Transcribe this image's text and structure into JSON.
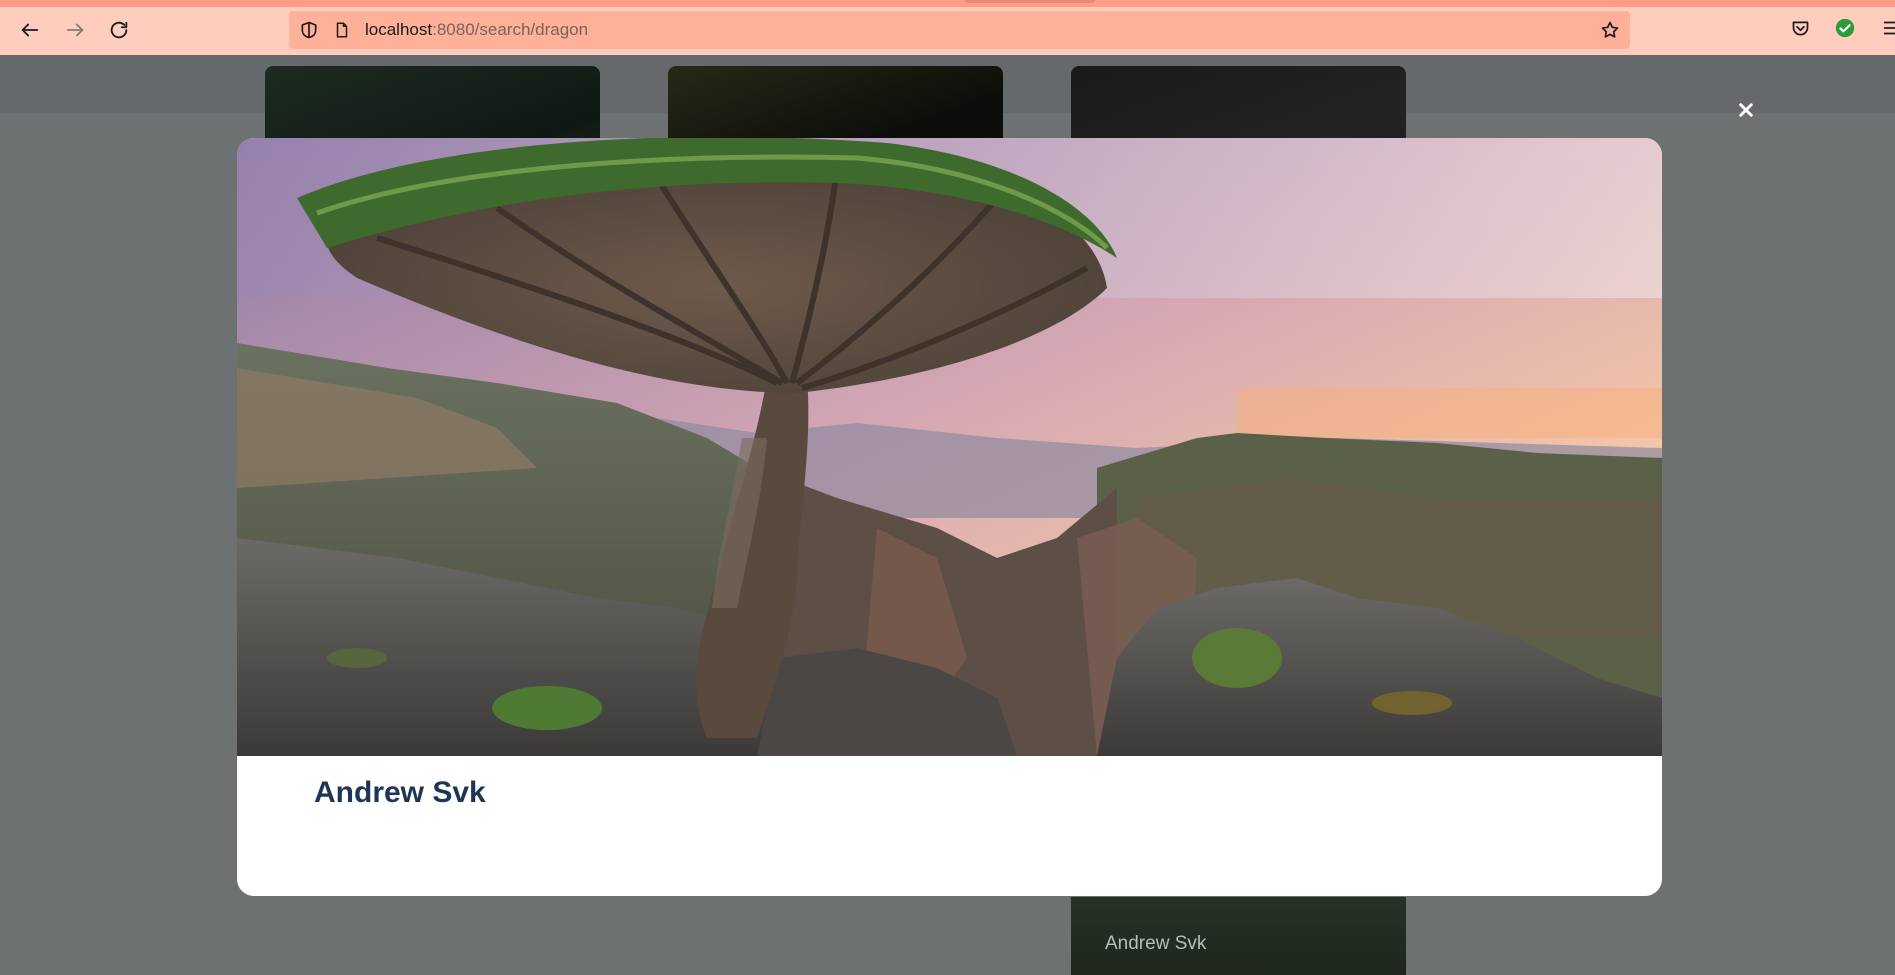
{
  "browser": {
    "url_host": "localhost",
    "url_rest": ":8080/search/dragon",
    "icons": {
      "back": "arrow-left-icon",
      "forward": "arrow-right-icon",
      "reload": "reload-icon",
      "shield": "shield-icon",
      "page": "page-icon",
      "bookmark": "star-icon",
      "pocket": "pocket-icon",
      "extension": "check-badge-icon",
      "menu": "hamburger-icon"
    },
    "colors": {
      "toolbar": "#ffcdbd",
      "urlbar": "#ffb098",
      "accent": "#ff9c86"
    }
  },
  "background_page": {
    "cards": [
      {
        "author": ""
      },
      {
        "author": ""
      },
      {
        "author": ""
      },
      {
        "author": "Andrew Svk"
      }
    ]
  },
  "modal": {
    "close_icon": "close-icon",
    "photo_subject": "dragon-blood-tree-over-canyon-at-sunset",
    "author": "Andrew Svk",
    "author_color": "#1e3555"
  }
}
